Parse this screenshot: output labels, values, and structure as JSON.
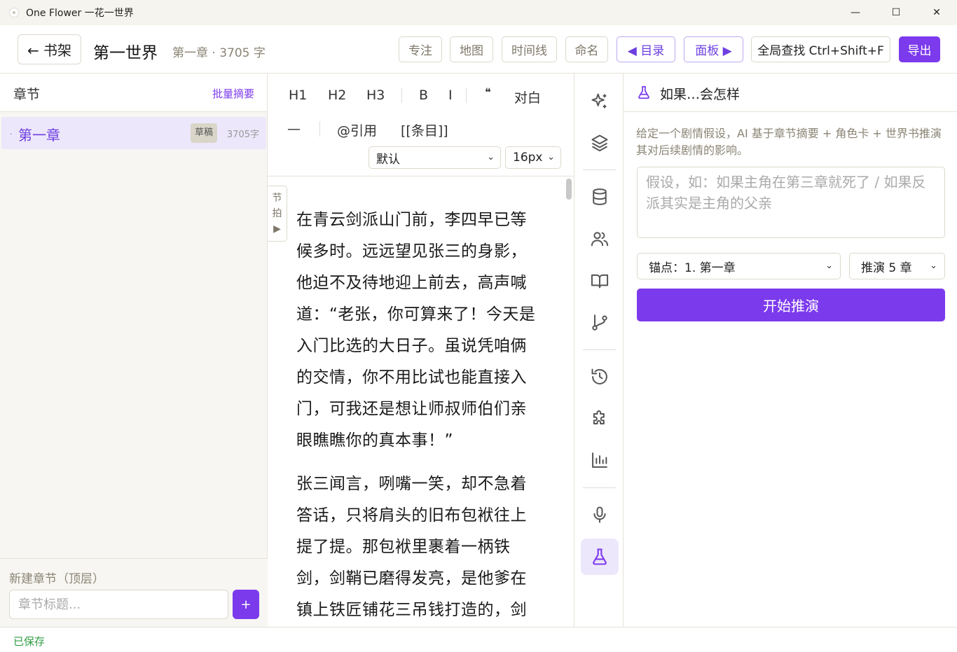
{
  "window": {
    "title": "One Flower 一花一世界",
    "minimize": "—",
    "maximize": "☐",
    "close": "✕"
  },
  "header": {
    "back_label": "← 书架",
    "book_title": "第一世界",
    "chapter_meta": "第一章 · 3705 字",
    "focus": "专注",
    "map": "地图",
    "timeline": "时间线",
    "naming": "命名",
    "toc": "◀ 目录",
    "panel": "面板 ▶",
    "global_search": "全局查找 Ctrl+Shift+F",
    "export": "导出"
  },
  "sidebar": {
    "title": "章节",
    "batch_summary": "批量摘要",
    "chapters": [
      {
        "name": "第一章",
        "badge": "草稿",
        "count": "3705字"
      }
    ],
    "new_chapter_label": "新建章节（顶层）",
    "new_chapter_placeholder": "章节标题...",
    "add_label": "+"
  },
  "editor": {
    "toolbar": {
      "h1": "H1",
      "h2": "H2",
      "h3": "H3",
      "bold": "B",
      "italic": "I",
      "quote": "❝",
      "dialogue": "对白",
      "hr": "—",
      "reference": "@引用",
      "entry": "[[条目]]",
      "font_select": "默认",
      "size_select": "16px"
    },
    "beat_tab": {
      "line1": "节",
      "line2": "拍",
      "arrow": "▶"
    },
    "paragraphs": [
      "在青云剑派山门前，李四早已等候多时。远远望见张三的身影，他迫不及待地迎上前去，高声喊道：“老张，你可算来了！今天是入门比选的大日子。虽说凭咱俩的交情，你不用比试也能直接入门，可我还是想让师叔师伯们亲眼瞧瞧你的真本事！”",
      "张三闻言，咧嘴一笑，却不急着答话，只将肩头的旧布包袱往上提了提。那包袱里裹着一柄铁剑，剑鞘已磨得发亮，是他爹在镇上铁匠铺花三吊钱打造的，剑"
    ]
  },
  "rail": {
    "icons": [
      "sparkles-icon",
      "layers-icon",
      "database-icon",
      "users-icon",
      "book-open-icon",
      "git-branch-icon",
      "history-icon",
      "puzzle-icon",
      "bar-chart-icon",
      "microphone-icon",
      "flask-icon"
    ]
  },
  "panel": {
    "title": "如果…会怎样",
    "description": "给定一个剧情假设，AI 基于章节摘要 + 角色卡 + 世界书推演其对后续剧情的影响。",
    "hypothesis_placeholder": "假设，如：如果主角在第三章就死了 / 如果反派其实是主角的父亲",
    "anchor_select": "锚点：1. 第一章",
    "depth_select": "推演 5 章",
    "start_button": "开始推演"
  },
  "status": {
    "saved": "已保存"
  },
  "colors": {
    "accent": "#7c3aed",
    "accent_light": "#ede7fb",
    "saved_green": "#2f9e44",
    "muted_text": "#8a8474"
  }
}
